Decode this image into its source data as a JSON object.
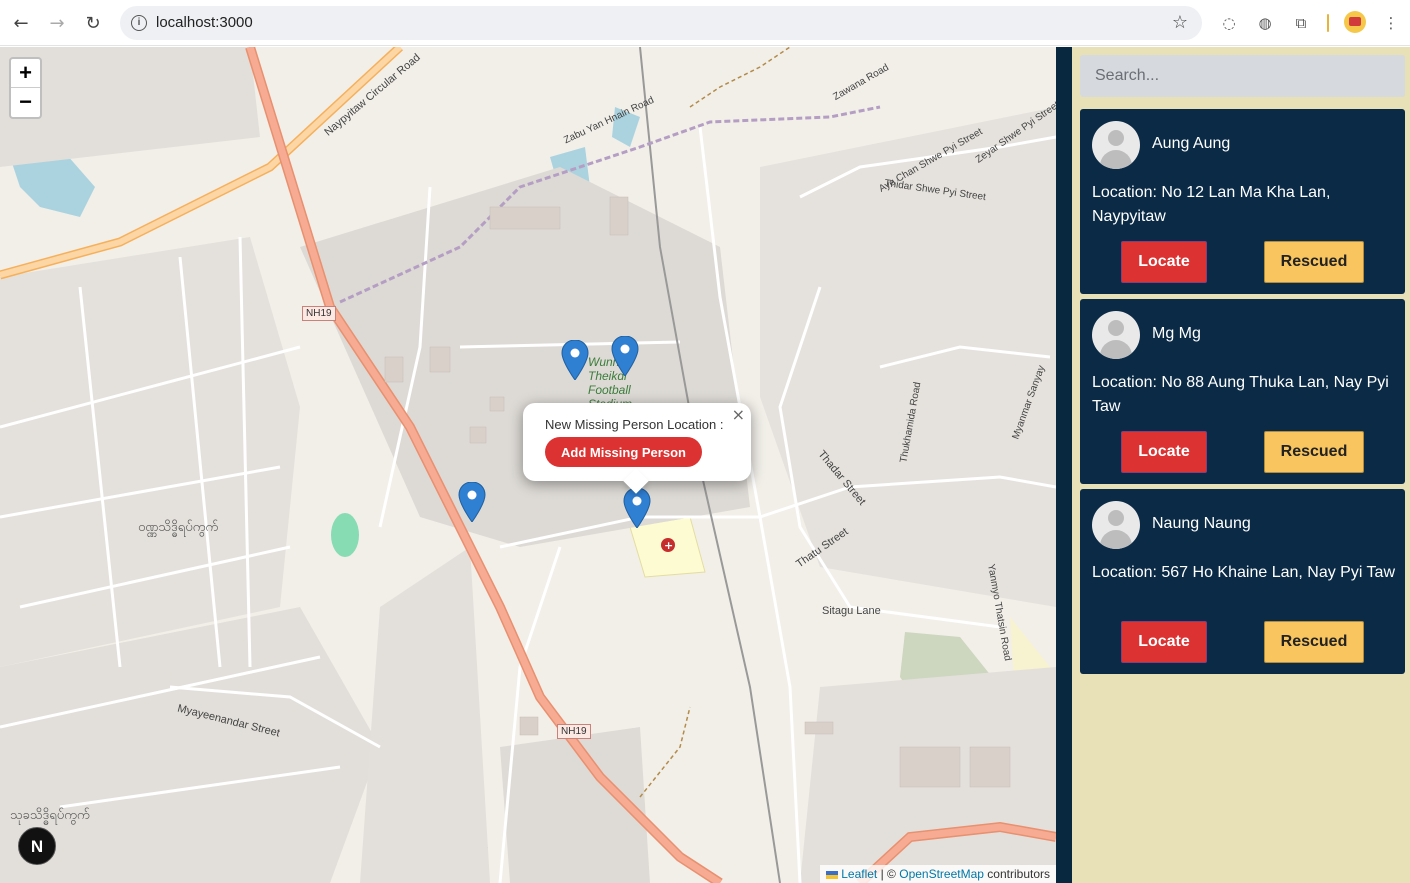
{
  "browser": {
    "url": "localhost:3000"
  },
  "map": {
    "zoom_in": "+",
    "zoom_out": "−",
    "labels": {
      "circular_road": "Naypyitaw Circular Road",
      "nh19_a": "NH19",
      "nh19_b": "NH19",
      "stadium": "Wunna Theikdi Football Stadium",
      "thadar_street": "Thadar Street",
      "thatu_street": "Thatu Street",
      "sitagu_lane": "Sitagu Lane",
      "myayeenandar": "Myayeenandar Street",
      "thidar_shwe_pyi": "Thidar Shwe Pyi Street",
      "aye_chan": "Aye Chan Shwe Pyi Street",
      "zeyar_shwe_pyi": "Zeyar Shwe Pyi Street",
      "zabu_yan": "Zabu Yan Hnain Road",
      "zawana": "Zawana Road",
      "thukhamida": "Thukhamida Road",
      "yanmyo": "Yanmyo Thatsin Road",
      "myanmar_sanyay": "Myanmar Sanyay",
      "burmese_1": "ဝဏ္ဏသိဒ္ဓိရပ်ကွက်",
      "burmese_2": "သုခသိဒ္ဓိရပ်ကွက်"
    },
    "markers_count": 4,
    "popup": {
      "title": "New Missing Person Location :",
      "button": "Add Missing Person",
      "close": "×"
    },
    "attribution": {
      "leaflet": "Leaflet",
      "sep": "| ©",
      "osm": "OpenStreetMap",
      "contributors": "contributors"
    },
    "nextjs_badge": "N"
  },
  "sidebar": {
    "search_placeholder": "Search...",
    "persons": [
      {
        "name": "Aung Aung",
        "location": "Location: No 12 Lan Ma Kha Lan, Naypyitaw",
        "locate": "Locate",
        "rescued": "Rescued"
      },
      {
        "name": "Mg Mg",
        "location": "Location: No 88 Aung Thuka Lan, Nay Pyi Taw",
        "locate": "Locate",
        "rescued": "Rescued"
      },
      {
        "name": "Naung Naung",
        "location": "Location: 567 Ho Khaine Lan, Nay Pyi Taw",
        "locate": "Locate",
        "rescued": "Rescued"
      }
    ]
  },
  "colors": {
    "sidebar_bg": "#e8e1b7",
    "card_bg": "#0a2a46",
    "locate": "#dc3232",
    "rescued": "#f8c55e",
    "marker": "#2f7fd3"
  }
}
